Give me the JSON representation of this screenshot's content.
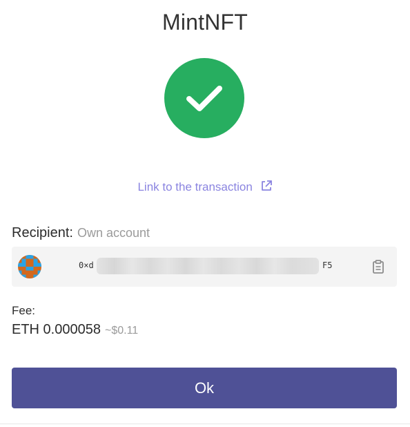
{
  "dialog": {
    "title": "MintNFT"
  },
  "status": {
    "icon": "check-icon",
    "color": "#27ae60"
  },
  "transaction_link": {
    "label": "Link to the transaction",
    "icon": "external-link-icon",
    "color": "#8a84e0"
  },
  "recipient": {
    "label": "Recipient:",
    "value": "Own account",
    "address_prefix": "0×d",
    "address_suffix": "F5",
    "copy_icon": "clipboard-icon"
  },
  "fee": {
    "label": "Fee:",
    "amount": "ETH 0.000058",
    "fiat": "~$0.11"
  },
  "actions": {
    "ok_label": "Ok",
    "ok_color": "#4f5196"
  }
}
